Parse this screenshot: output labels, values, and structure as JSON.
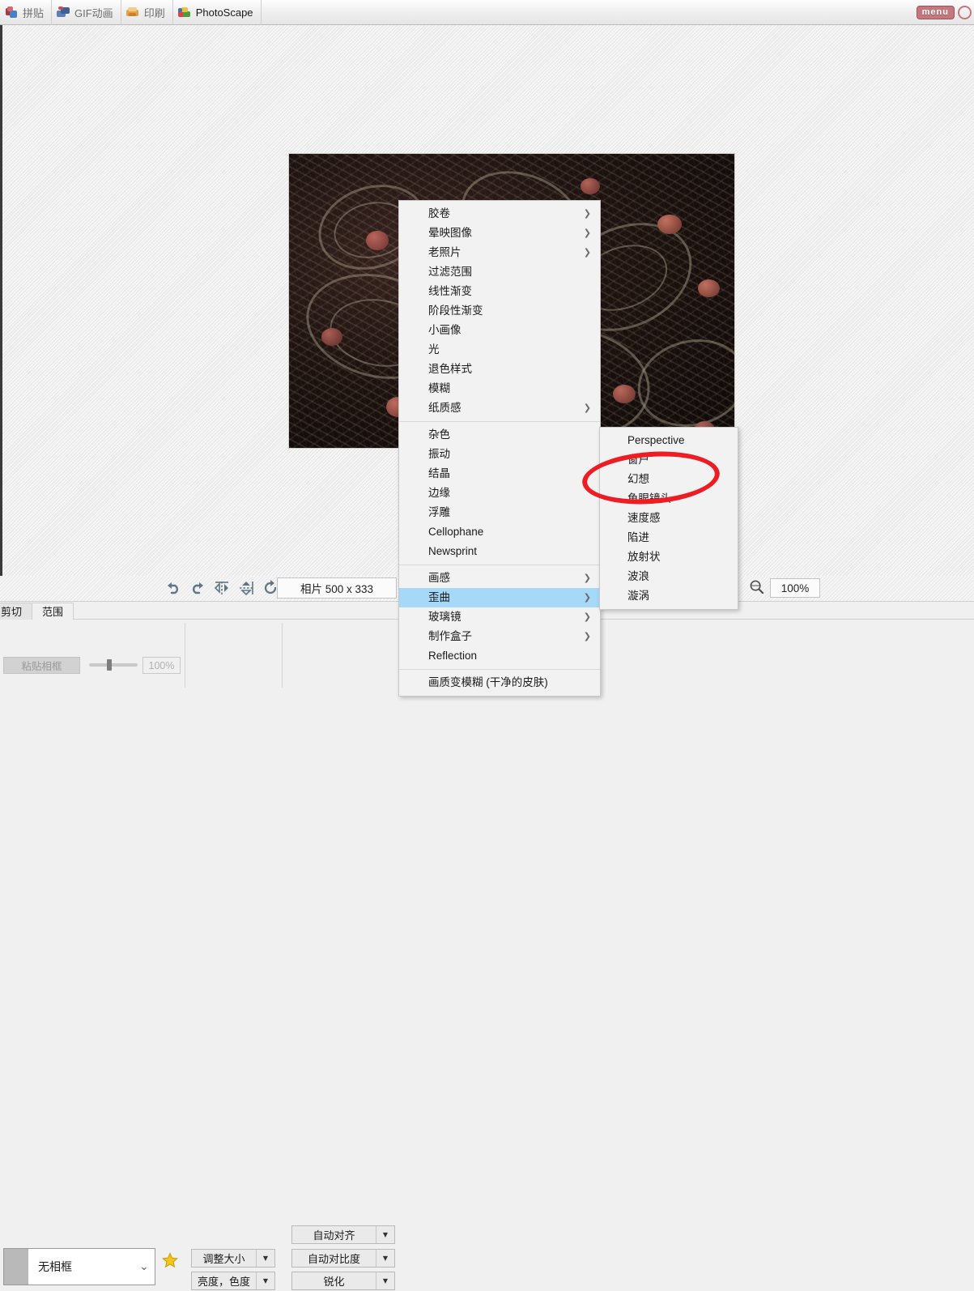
{
  "app": {
    "name": "PhotoScape",
    "top_tabs": [
      {
        "label": "拼贴",
        "icon": "collage-icon",
        "active": false
      },
      {
        "label": "GIF动画",
        "icon": "gif-animation-icon",
        "active": false
      },
      {
        "label": "印刷",
        "icon": "print-icon",
        "active": false
      },
      {
        "label": "PhotoScape",
        "icon": "photoscape-icon",
        "active": true
      }
    ],
    "menu_badge": "menu",
    "window_button": "close-button"
  },
  "canvas": {
    "photo_alt": "dark photograph of coiled fishing ropes and nets with red floats"
  },
  "context_menu": {
    "groups": [
      {
        "items": [
          {
            "label": "胶卷",
            "submenu": true
          },
          {
            "label": "晕映图像",
            "submenu": true
          },
          {
            "label": "老照片",
            "submenu": true
          },
          {
            "label": "过滤范围",
            "submenu": false
          },
          {
            "label": "线性渐变",
            "submenu": false
          },
          {
            "label": "阶段性渐变",
            "submenu": false
          },
          {
            "label": "小画像",
            "submenu": false
          },
          {
            "label": "光",
            "submenu": false
          },
          {
            "label": "退色样式",
            "submenu": false
          },
          {
            "label": "模糊",
            "submenu": false
          },
          {
            "label": "纸质感",
            "submenu": true
          }
        ]
      },
      {
        "items": [
          {
            "label": "杂色",
            "submenu": false
          },
          {
            "label": "振动",
            "submenu": false
          },
          {
            "label": "结晶",
            "submenu": false
          },
          {
            "label": "边缘",
            "submenu": false
          },
          {
            "label": "浮雕",
            "submenu": false
          },
          {
            "label": "Cellophane",
            "submenu": false
          },
          {
            "label": "Newsprint",
            "submenu": false
          }
        ]
      },
      {
        "items": [
          {
            "label": "画感",
            "submenu": true
          },
          {
            "label": "歪曲",
            "submenu": true,
            "selected": true
          },
          {
            "label": "玻璃镜",
            "submenu": true
          },
          {
            "label": "制作盒子",
            "submenu": true
          },
          {
            "label": "Reflection",
            "submenu": false
          }
        ]
      },
      {
        "items": [
          {
            "label": "画质变模糊 (干净的皮肤)",
            "submenu": false
          }
        ]
      }
    ]
  },
  "submenu": {
    "items": [
      {
        "label": "Perspective"
      },
      {
        "label": "窗户"
      },
      {
        "label": "幻想"
      },
      {
        "label": "鱼眼镜头"
      },
      {
        "label": "速度感"
      },
      {
        "label": "陷进"
      },
      {
        "label": "放射状"
      },
      {
        "label": "波浪"
      },
      {
        "label": "漩涡"
      }
    ]
  },
  "annotation": {
    "shape": "red-ellipse-highlight",
    "color": "#ee1c23",
    "targets": [
      "窗户",
      "幻想"
    ]
  },
  "toolbar": {
    "icons": [
      {
        "name": "undo-icon",
        "title": "撤销"
      },
      {
        "name": "redo-icon",
        "title": "重做"
      },
      {
        "name": "flip-horizontal-icon",
        "title": "水平翻转"
      },
      {
        "name": "flip-vertical-icon",
        "title": "垂直翻转"
      },
      {
        "name": "rotate-icon",
        "title": "旋转"
      }
    ],
    "size_label": "相片 500 x 333",
    "zoom_icon": "zoom-icon",
    "zoom_value": "100%"
  },
  "bottom": {
    "tabs": [
      {
        "label": "剪切",
        "active": false,
        "clipped": true
      },
      {
        "label": "范围",
        "active": true,
        "clipped": false
      }
    ],
    "paste_frame_button": "粘贴相框",
    "opacity_slider_value": "100%",
    "frame_select_value": "无相框",
    "favorite_icon": "star-icon",
    "buttons": [
      {
        "label": "调整大小",
        "dropdown": true
      },
      {
        "label": "亮度，色度",
        "dropdown": true
      },
      {
        "label": "自动对齐",
        "dropdown": true
      },
      {
        "label": "自动对比度",
        "dropdown": true
      },
      {
        "label": "锐化",
        "dropdown": true
      }
    ]
  },
  "colors": {
    "menu_highlight": "#a6d8f7",
    "annotation_red": "#ee1c23",
    "badge_red": "#c4777c",
    "panel_bg": "#f0f0f0"
  }
}
